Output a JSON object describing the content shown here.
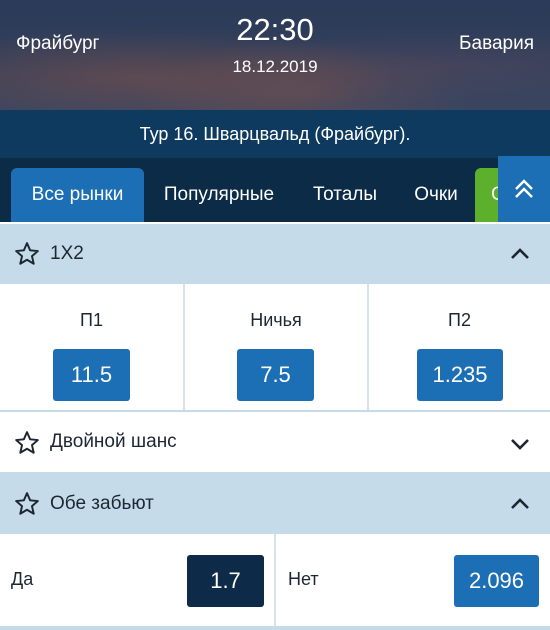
{
  "match": {
    "home_team": "Фрайбург",
    "away_team": "Бавария",
    "time": "22:30",
    "date": "18.12.2019",
    "round": "Тур 16. Шварцвальд (Фрайбург)."
  },
  "tabs": [
    {
      "label": "Все рынки",
      "active": true
    },
    {
      "label": "Популярные",
      "active": false
    },
    {
      "label": "Тоталы",
      "active": false
    },
    {
      "label": "Очки",
      "active": false
    },
    {
      "label": "С",
      "active": false
    }
  ],
  "markets": {
    "x12": {
      "title": "1X2",
      "expanded": true,
      "outcomes": [
        {
          "label": "П1",
          "odd": "11.5"
        },
        {
          "label": "Ничья",
          "odd": "7.5"
        },
        {
          "label": "П2",
          "odd": "1.235"
        }
      ]
    },
    "double_chance": {
      "title": "Двойной шанс",
      "expanded": false
    },
    "both_score": {
      "title": "Обе забьют",
      "expanded": true,
      "outcomes": [
        {
          "label": "Да",
          "odd": "1.7",
          "selected": true
        },
        {
          "label": "Нет",
          "odd": "2.096",
          "selected": false
        }
      ]
    }
  },
  "colors": {
    "header_bg": "#33405c",
    "round_bar": "#0e3a5f",
    "tabs_bg": "#0b2b47",
    "accent_blue": "#1d6fb5",
    "selected_odd": "#0d2b48",
    "section_bg": "#c6dbe9",
    "tab_green": "#5cb02c"
  },
  "icons": [
    "star-icon",
    "chevron-up-icon",
    "chevron-down-icon",
    "double-chevron-up-icon"
  ]
}
